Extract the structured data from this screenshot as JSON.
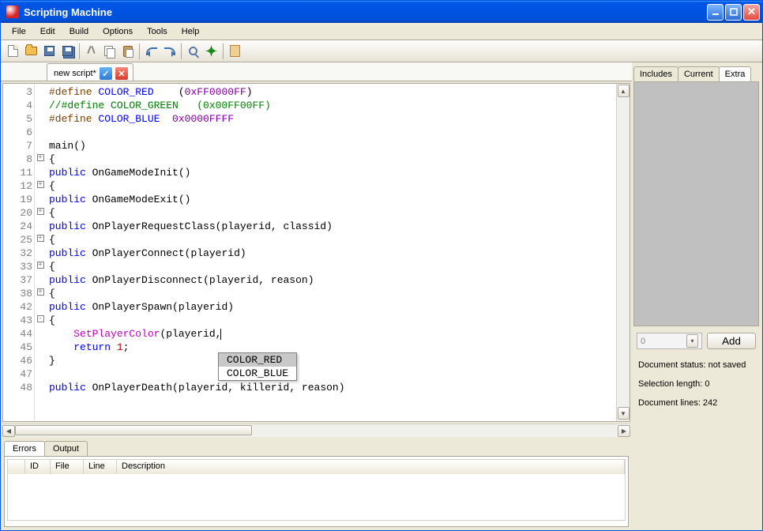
{
  "title": "Scripting Machine",
  "menu": [
    "File",
    "Edit",
    "Build",
    "Options",
    "Tools",
    "Help"
  ],
  "file_tab": {
    "label": "new script*"
  },
  "gutter": [
    "3",
    "4",
    "5",
    "6",
    "7",
    "8",
    "11",
    "12",
    "19",
    "20",
    "24",
    "25",
    "32",
    "33",
    "37",
    "38",
    "42",
    "43",
    "44",
    "45",
    "46",
    "47",
    "48"
  ],
  "fold": [
    "",
    "",
    "",
    "",
    "",
    "+",
    "",
    "+",
    "",
    "+",
    "",
    "+",
    "",
    "+",
    "",
    "+",
    "",
    "-",
    "",
    "",
    "",
    "",
    ""
  ],
  "code_lines": [
    {
      "segs": [
        {
          "c": "k-pp",
          "t": "#define "
        },
        {
          "c": "k-def",
          "t": "COLOR_RED"
        },
        {
          "c": "",
          "t": "    "
        },
        {
          "c": "k-paren",
          "t": "("
        },
        {
          "c": "k-val",
          "t": "0xFF0000FF"
        },
        {
          "c": "k-paren",
          "t": ")"
        }
      ]
    },
    {
      "segs": [
        {
          "c": "k-comment",
          "t": "//#define COLOR_GREEN   (0x00FF00FF)"
        }
      ]
    },
    {
      "segs": [
        {
          "c": "k-pp",
          "t": "#define "
        },
        {
          "c": "k-def",
          "t": "COLOR_BLUE"
        },
        {
          "c": "",
          "t": "  "
        },
        {
          "c": "k-val",
          "t": "0x0000FFFF"
        }
      ]
    },
    {
      "segs": [
        {
          "c": "",
          "t": ""
        }
      ]
    },
    {
      "segs": [
        {
          "c": "k-func",
          "t": "main"
        },
        {
          "c": "k-paren",
          "t": "()"
        }
      ]
    },
    {
      "segs": [
        {
          "c": "",
          "t": "{"
        }
      ]
    },
    {
      "segs": [
        {
          "c": "k-kw",
          "t": "public"
        },
        {
          "c": "",
          "t": " "
        },
        {
          "c": "k-func",
          "t": "OnGameModeInit"
        },
        {
          "c": "k-paren",
          "t": "()"
        }
      ]
    },
    {
      "segs": [
        {
          "c": "",
          "t": "{"
        }
      ]
    },
    {
      "segs": [
        {
          "c": "k-kw",
          "t": "public"
        },
        {
          "c": "",
          "t": " "
        },
        {
          "c": "k-func",
          "t": "OnGameModeExit"
        },
        {
          "c": "k-paren",
          "t": "()"
        }
      ]
    },
    {
      "segs": [
        {
          "c": "",
          "t": "{"
        }
      ]
    },
    {
      "segs": [
        {
          "c": "k-kw",
          "t": "public"
        },
        {
          "c": "",
          "t": " "
        },
        {
          "c": "k-func",
          "t": "OnPlayerRequestClass"
        },
        {
          "c": "k-paren",
          "t": "("
        },
        {
          "c": "k-id",
          "t": "playerid"
        },
        {
          "c": "",
          "t": ", "
        },
        {
          "c": "k-id",
          "t": "classid"
        },
        {
          "c": "k-paren",
          "t": ")"
        }
      ]
    },
    {
      "segs": [
        {
          "c": "",
          "t": "{"
        }
      ]
    },
    {
      "segs": [
        {
          "c": "k-kw",
          "t": "public"
        },
        {
          "c": "",
          "t": " "
        },
        {
          "c": "k-func",
          "t": "OnPlayerConnect"
        },
        {
          "c": "k-paren",
          "t": "("
        },
        {
          "c": "k-id",
          "t": "playerid"
        },
        {
          "c": "k-paren",
          "t": ")"
        }
      ]
    },
    {
      "segs": [
        {
          "c": "",
          "t": "{"
        }
      ]
    },
    {
      "segs": [
        {
          "c": "k-kw",
          "t": "public"
        },
        {
          "c": "",
          "t": " "
        },
        {
          "c": "k-func",
          "t": "OnPlayerDisconnect"
        },
        {
          "c": "k-paren",
          "t": "("
        },
        {
          "c": "k-id",
          "t": "playerid"
        },
        {
          "c": "",
          "t": ", "
        },
        {
          "c": "k-id",
          "t": "reason"
        },
        {
          "c": "k-paren",
          "t": ")"
        }
      ]
    },
    {
      "segs": [
        {
          "c": "",
          "t": "{"
        }
      ]
    },
    {
      "segs": [
        {
          "c": "k-kw",
          "t": "public"
        },
        {
          "c": "",
          "t": " "
        },
        {
          "c": "k-func",
          "t": "OnPlayerSpawn"
        },
        {
          "c": "k-paren",
          "t": "("
        },
        {
          "c": "k-id",
          "t": "playerid"
        },
        {
          "c": "k-paren",
          "t": ")"
        }
      ]
    },
    {
      "segs": [
        {
          "c": "",
          "t": "{"
        }
      ]
    },
    {
      "segs": [
        {
          "c": "",
          "t": "    "
        },
        {
          "c": "k-call",
          "t": "SetPlayerColor"
        },
        {
          "c": "k-paren",
          "t": "("
        },
        {
          "c": "k-id",
          "t": "playerid"
        },
        {
          "c": "",
          "t": ","
        }
      ],
      "caret": true
    },
    {
      "segs": [
        {
          "c": "",
          "t": "    "
        },
        {
          "c": "k-kw",
          "t": "return"
        },
        {
          "c": "",
          "t": " "
        },
        {
          "c": "k-num",
          "t": "1"
        },
        {
          "c": "",
          "t": ";"
        }
      ]
    },
    {
      "segs": [
        {
          "c": "",
          "t": "}"
        }
      ]
    },
    {
      "segs": [
        {
          "c": "",
          "t": ""
        }
      ]
    },
    {
      "segs": [
        {
          "c": "k-kw",
          "t": "public"
        },
        {
          "c": "",
          "t": " "
        },
        {
          "c": "k-func",
          "t": "OnPlayerDeath"
        },
        {
          "c": "k-paren",
          "t": "("
        },
        {
          "c": "k-id",
          "t": "playerid"
        },
        {
          "c": "",
          "t": ", "
        },
        {
          "c": "k-id",
          "t": "killerid"
        },
        {
          "c": "",
          "t": ", "
        },
        {
          "c": "k-id",
          "t": "reason"
        },
        {
          "c": "k-paren",
          "t": ")"
        }
      ]
    }
  ],
  "autocomplete": {
    "items": [
      "COLOR_RED",
      "COLOR_BLUE"
    ],
    "selected": 0
  },
  "bottom_tabs": [
    "Errors",
    "Output"
  ],
  "bottom_active": 0,
  "err_cols": [
    "",
    "ID",
    "File",
    "Line",
    "Description"
  ],
  "right_tabs": [
    "Includes",
    "Current",
    "Extra"
  ],
  "right_active": 2,
  "combo_value": "0",
  "add_label": "Add",
  "status": {
    "doc": "Document status: not saved",
    "sel": "Selection length: 0",
    "lines": "Document lines: 242"
  }
}
